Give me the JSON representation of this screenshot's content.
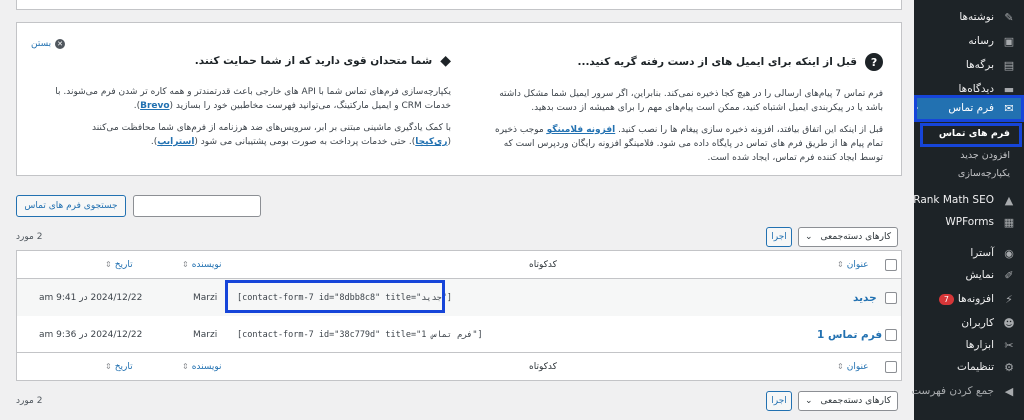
{
  "sidebar": {
    "items": [
      {
        "label": "نوشته‌ها",
        "icon": "pin-icon"
      },
      {
        "label": "رسانه",
        "icon": "media-icon"
      },
      {
        "label": "برگه‌ها",
        "icon": "pages-icon"
      },
      {
        "label": "دیدگاه‌ها",
        "icon": "comments-icon"
      },
      {
        "label": "فرم تماس",
        "icon": "mail-icon"
      },
      {
        "label": "Rank Math SEO",
        "icon": "rankmath-icon"
      },
      {
        "label": "WPForms",
        "icon": "wpforms-icon"
      },
      {
        "label": "آسترا",
        "icon": "astra-icon"
      },
      {
        "label": "نمایش",
        "icon": "brush-icon"
      },
      {
        "label": "افزونه‌ها",
        "icon": "plugin-icon",
        "badge": "7"
      },
      {
        "label": "کاربران",
        "icon": "users-icon"
      },
      {
        "label": "ابزارها",
        "icon": "tools-icon"
      },
      {
        "label": "تنظیمات",
        "icon": "settings-icon"
      },
      {
        "label": "جمع کردن فهرست",
        "icon": "collapse-icon"
      }
    ],
    "submenu": [
      "فرم های تماس",
      "افزودن جدید",
      "یکپارچه‌سازی"
    ]
  },
  "notice": {
    "dismiss": "بستن",
    "right": {
      "heading": "قبل از اینکه برای ایمیل های از دست رفته گریه کنید...",
      "p1": "فرم تماس 7 پیام‌های ارسالی را در هیچ کجا ذخیره نمی‌کند. بنابراین، اگر سرور ایمیل شما مشکل داشته باشد یا در پیکربندی ایمیل اشتباه کنید، ممکن است پیام‌های مهم را برای همیشه از دست بدهید.",
      "p2_a": "قبل از اینکه این اتفاق بیافتد، افزونه ذخیره سازی پیغام ها را نصب کنید.",
      "p2_link": "افزونه فلامینگو",
      "p2_b": "موجب ذخیره تمام پیام ها از طریق فرم های تماس در پایگاه داده می شود. فلامینگو افزونه رایگان وردپرس است که توسط ایجاد کننده فرم تماس، ایجاد شده است."
    },
    "left": {
      "heading": "شما متحدان قوی دارید که از شما حمایت کنند.",
      "p1_a": "یکپارچه‌سازی فرم‌های تماس شما با API های خارجی باعث قدرتمندتر و همه کاره تر شدن فرم می‌شوند. با خدمات CRM و ایمیل مارکتینگ، می‌توانید فهرست مخاطبین خود را بسازید",
      "p1_link": "Brevo",
      "p2_a": "با کمک یادگیری ماشینی مبتنی بر ابر، سرویس‌های ضد هرزنامه از فرم‌های شما محافظت می‌کنند",
      "p2_link1": "ری‌کپچا",
      "p2_b": "حتی خدمات پرداخت به صورت بومی پشتیبانی می شود",
      "p2_link2": "استرایپ"
    }
  },
  "search": {
    "button": "جستجوی فرم های تماس",
    "placeholder": ""
  },
  "bulk": {
    "select": "کارهای دسته‌جمعی",
    "apply": "اجرا",
    "count": "2 مورد"
  },
  "table": {
    "headers": {
      "title": "عنوان",
      "shortcode": "کدکوتاه",
      "author": "نویسنده",
      "date": "تاریخ"
    },
    "rows": [
      {
        "title": "جدید",
        "shortcode": "[contact-form-7 id=\"8dbb8c8\" title=\"جدید\"]",
        "author": "Marzi",
        "date": "2024/12/22 در 9:41 am"
      },
      {
        "title": "فرم تماس 1",
        "shortcode": "[contact-form-7 id=\"38c779d\" title=\"فرم تماس 1\"]",
        "author": "Marzi",
        "date": "2024/12/22 در 9:36 am"
      }
    ]
  },
  "colors": {
    "accent": "#2271b1",
    "highlight": "#1645d9",
    "sidebar": "#1d2327"
  }
}
